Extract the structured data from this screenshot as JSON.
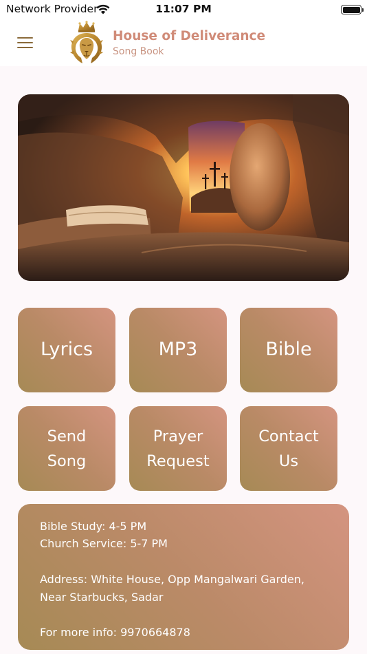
{
  "status_bar": {
    "carrier": "Network Provider",
    "time": "11:07 PM",
    "wifi_icon": "wifi-icon",
    "battery_icon": "battery-full-icon"
  },
  "header": {
    "menu_icon": "hamburger-menu-icon",
    "logo": "crowned-lion-logo",
    "title": "House of Deliverance",
    "subtitle": "Song Book"
  },
  "hero": {
    "description_icon": "empty-tomb-three-crosses-image"
  },
  "menu_tiles": [
    {
      "lines": [
        "Lyrics"
      ]
    },
    {
      "lines": [
        "MP3"
      ]
    },
    {
      "lines": [
        "Bible"
      ]
    },
    {
      "lines": [
        "Send",
        "Song"
      ]
    },
    {
      "lines": [
        "Prayer",
        "Request"
      ]
    },
    {
      "lines": [
        "Contact",
        "Us"
      ]
    }
  ],
  "info": {
    "bible_study": "Bible Study: 4-5 PM",
    "church_service": "Church Service: 5-7 PM",
    "address_line1": "Address: White House, Opp Mangalwari Garden,",
    "address_line2": "Near Starbucks, Sadar",
    "more_info": "For more info: 9970664878"
  },
  "colors": {
    "accent_title": "#d08b78",
    "tile_gradient_start": "#a68a55",
    "tile_gradient_end": "#d49480",
    "background": "#fdf8fa"
  }
}
